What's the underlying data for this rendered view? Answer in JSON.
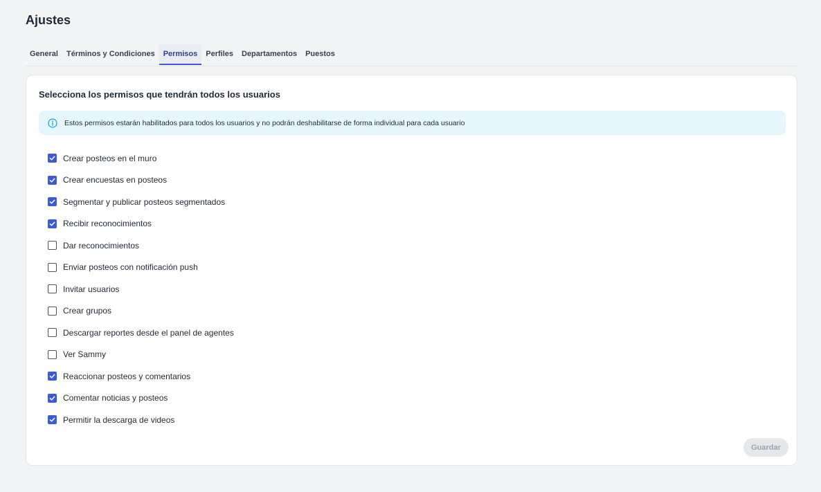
{
  "page": {
    "title": "Ajustes"
  },
  "tabs": [
    {
      "label": "General",
      "active": false
    },
    {
      "label": "Términos y Condiciones",
      "active": false
    },
    {
      "label": "Permisos",
      "active": true
    },
    {
      "label": "Perfiles",
      "active": false
    },
    {
      "label": "Departamentos",
      "active": false
    },
    {
      "label": "Puestos",
      "active": false
    }
  ],
  "permissions_card": {
    "title": "Selecciona los permisos que tendrán todos los usuarios",
    "info_icon": "info-circle-icon",
    "info_text": "Estos permisos estarán habilitados para todos los usuarios y no podrán deshabilitarse de forma individual para cada usuario",
    "items": [
      {
        "label": "Crear posteos en el muro",
        "checked": true
      },
      {
        "label": "Crear encuestas en posteos",
        "checked": true
      },
      {
        "label": "Segmentar y publicar posteos segmentados",
        "checked": true
      },
      {
        "label": "Recibir reconocimientos",
        "checked": true
      },
      {
        "label": "Dar reconocimientos",
        "checked": false
      },
      {
        "label": "Enviar posteos con notificación push",
        "checked": false
      },
      {
        "label": "Invitar usuarios",
        "checked": false
      },
      {
        "label": "Crear grupos",
        "checked": false
      },
      {
        "label": "Descargar reportes desde el panel de agentes",
        "checked": false
      },
      {
        "label": "Ver Sammy",
        "checked": false
      },
      {
        "label": "Reaccionar posteos y comentarios",
        "checked": true
      },
      {
        "label": "Comentar noticias y posteos",
        "checked": true
      },
      {
        "label": "Permitir la descarga de videos",
        "checked": true
      }
    ],
    "save_label": "Guardar",
    "save_disabled": true
  },
  "colors": {
    "accent": "#3b5bdb",
    "active_tab_text": "#2f3f8f",
    "info_background": "#e6f6fd",
    "info_icon": "#0ea5e9",
    "page_background": "#f3f4f6"
  }
}
